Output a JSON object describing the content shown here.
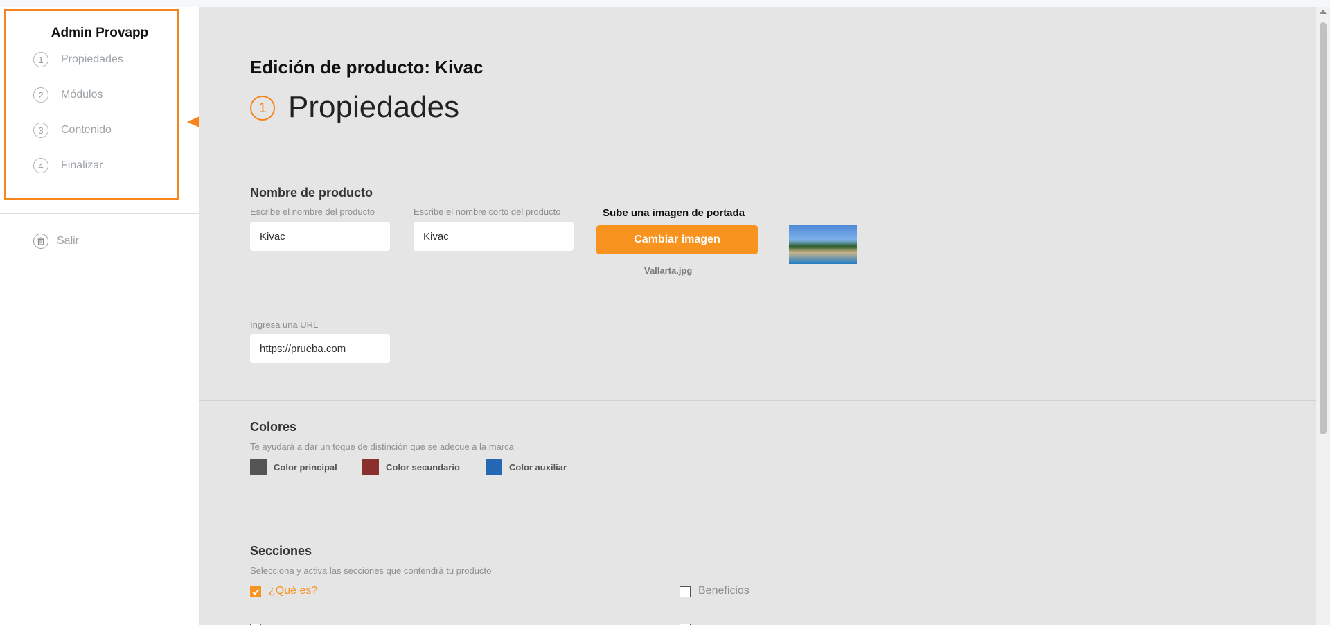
{
  "sidebar": {
    "brand": "Admin Provapp",
    "steps": [
      {
        "num": "1",
        "label": "Propiedades"
      },
      {
        "num": "2",
        "label": "Módulos"
      },
      {
        "num": "3",
        "label": "Contenido"
      },
      {
        "num": "4",
        "label": "Finalizar"
      }
    ],
    "exit_label": "Salir"
  },
  "main": {
    "page_title": "Edición de producto: Kivac",
    "section_number": "1",
    "section_title": "Propiedades",
    "product": {
      "heading": "Nombre de producto",
      "name_hint": "Escribe el nombre del producto",
      "name_value": "Kivac",
      "short_hint": "Escribe el nombre corto del producto",
      "short_value": "Kivac",
      "upload_heading": "Sube una imagen de portada",
      "upload_button": "Cambiar imagen",
      "file_name": "Vallarta.jpg",
      "url_hint": "Ingresa una URL",
      "url_value": "https://prueba.com"
    },
    "colors": {
      "heading": "Colores",
      "hint": "Te ayudará a dar un toque de distinción que se adecue a la marca",
      "items": [
        {
          "label": "Color principal",
          "color": "#545454"
        },
        {
          "label": "Color secundario",
          "color": "#8b2e2e"
        },
        {
          "label": "Color auxiliar",
          "color": "#2467b3"
        }
      ]
    },
    "sections": {
      "heading": "Secciones",
      "hint": "Selecciona y activa las secciones que contendrá tu producto",
      "items": [
        {
          "label": "¿Qué es?",
          "checked": true
        },
        {
          "label": "Beneficios",
          "checked": false
        }
      ]
    }
  },
  "accent": "#f7931e",
  "highlight": "#f7851f"
}
